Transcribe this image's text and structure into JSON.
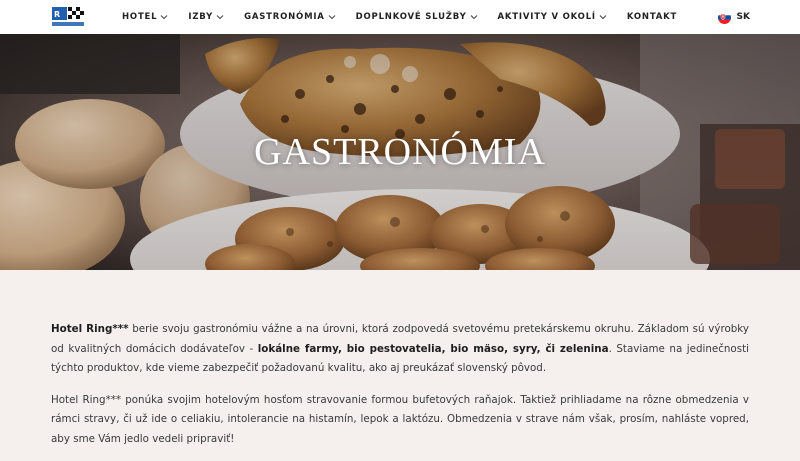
{
  "header": {
    "logo_icon": "hotel-ring-logo",
    "nav": [
      {
        "label": "HOTEL",
        "has_dropdown": true
      },
      {
        "label": "IZBY",
        "has_dropdown": true
      },
      {
        "label": "GASTRONÓMIA",
        "has_dropdown": true
      },
      {
        "label": "DOPLNKOVÉ SLUŽBY",
        "has_dropdown": true
      },
      {
        "label": "AKTIVITY V OKOLÍ",
        "has_dropdown": true
      },
      {
        "label": "KONTAKT",
        "has_dropdown": false
      }
    ],
    "language": {
      "code": "SK",
      "flag_icon": "slovak-flag-icon"
    }
  },
  "hero": {
    "title": "GASTRONÓMIA"
  },
  "content": {
    "p1": {
      "hotel_name": "Hotel Ring***",
      "text1": " berie svoju gastronómiu vážne a na úrovni, ktorá zodpovedá svetovému pretekárskemu okruhu. Základom sú výrobky od kvalitných domácich dodávateľov - ",
      "bold": "lokálne farmy, bio pestovatelia, bio mäso, syry, či zelenina",
      "text2": ". Staviame na jedinečnosti týchto produktov, kde vieme zabezpečiť požadovanú kvalitu, ako aj preukázať slovenský pôvod."
    },
    "p2": "Hotel Ring*** ponúka svojim hotelovým hosťom stravovanie formou bufetových raňajok. Taktiež prihliadame na rôzne obmedzenia v rámci stravy, či už ide o celiakiu, intolerancie na histamín, lepok a laktózu. Obmedzenia v strave nám však, prosím, nahláste vopred, aby sme Vám jedlo vedeli pripraviť!"
  },
  "colors": {
    "page_bg": "#f5efed",
    "header_bg": "#ffffff",
    "text": "#3a3a3a",
    "logo_blue": "#1f5fae"
  }
}
